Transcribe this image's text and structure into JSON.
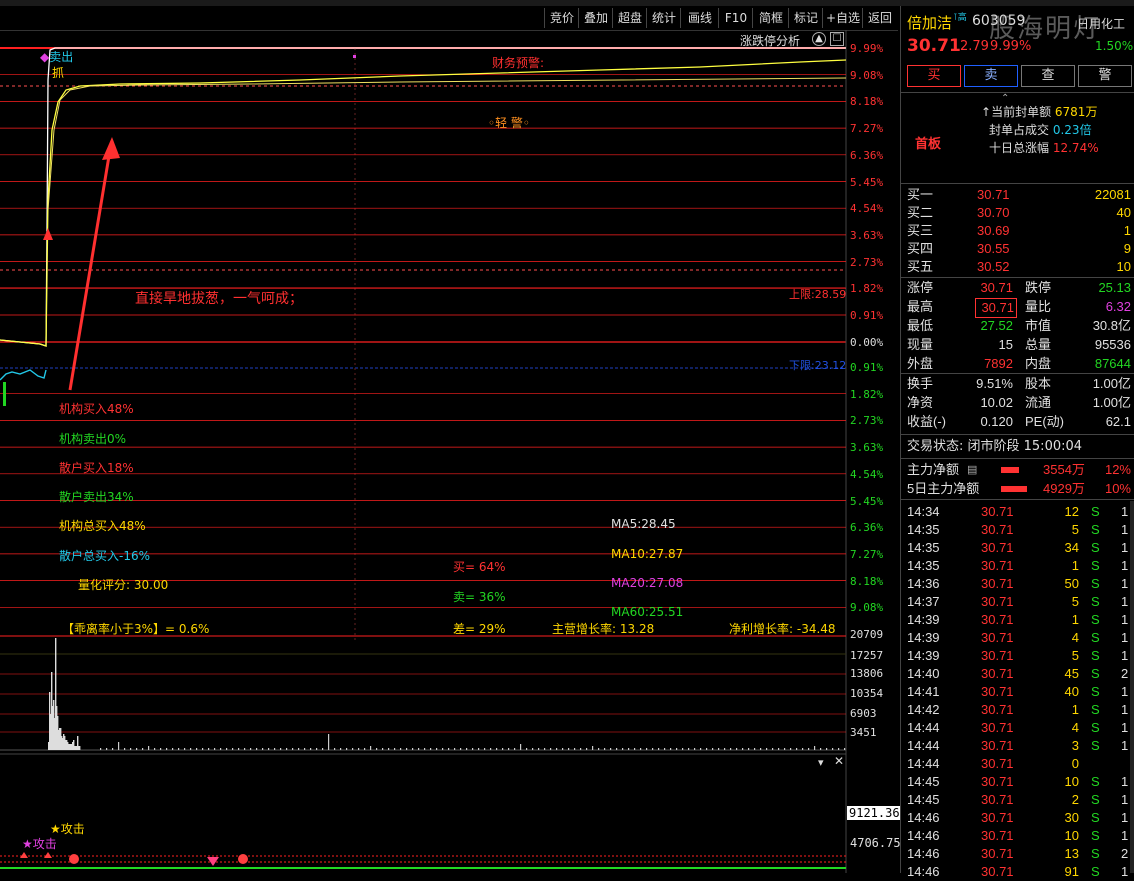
{
  "toolbar": {
    "items": [
      "竞价",
      "叠加",
      "超盘",
      "统计",
      "画线",
      "F10",
      "简框",
      "标记",
      "+自选",
      "返回"
    ]
  },
  "chart": {
    "analysis_label": "涨跌停分析",
    "pct_upper": [
      "9.99%",
      "9.08%",
      "8.18%",
      "7.27%",
      "6.36%",
      "5.45%",
      "4.54%",
      "3.63%",
      "2.73%",
      "1.82%",
      "0.91%",
      "0.00%"
    ],
    "pct_lower": [
      "0.91%",
      "1.82%",
      "2.73%",
      "3.63%",
      "4.54%",
      "5.45%",
      "6.36%",
      "7.27%",
      "8.18%",
      "9.08%"
    ],
    "vol_ticks": [
      "20709",
      "17257",
      "13806",
      "10354",
      "6903",
      "3451"
    ],
    "sub_ticks": [
      "9121.36",
      "4706.75"
    ],
    "sell_label": "卖出",
    "grab_label": "抓",
    "warning_label": "财务预警:",
    "light_warning": "◦轻 警◦",
    "annotation": "直接旱地拔葱，一气呵成；",
    "upper_limit": "上限:28.59",
    "lower_limit": "下限:23.12",
    "attack1": "★攻击",
    "attack2": "★攻击"
  },
  "indicators": {
    "inst_buy": "机构买入48%",
    "inst_sell": "机构卖出0%",
    "retail_buy": "散户买入18%",
    "retail_sell": "散户卖出34%",
    "inst_total": "机构总买入48%",
    "retail_total": "散户总买入-16%",
    "quant_score": "量化评分: 30.00",
    "deviation": "【乖离率小于3%】= 0.6%",
    "buy": "买= 64%",
    "sell": "卖= 36%",
    "diff": "差= 29%",
    "ma5": "MA5:28.45",
    "ma10": "MA10:27.87",
    "ma20": "MA20:27.08",
    "ma60": "MA60:25.51",
    "main_growth": "主营增长率: 13.28",
    "net_growth": "净利增长率: -34.48"
  },
  "stock": {
    "name": "倍加洁",
    "high_tag": "高",
    "code": "603059",
    "industry": "日用化工",
    "price": "30.71",
    "change": "2.79",
    "change_pct": "9.99%",
    "right_pct": "1.50%",
    "watermark": "股海明灯",
    "buy_btn": "买",
    "sell_btn": "卖",
    "check_btn": "查",
    "alert_btn": "警",
    "board": "首板",
    "seal_amount_label": "当前封单额",
    "seal_amount": "6781万",
    "seal_ratio_label": "封单占成交",
    "seal_ratio": "0.23倍",
    "ten_day_label": "十日总涨幅",
    "ten_day": "12.74%"
  },
  "orderbook": [
    {
      "label": "买一",
      "price": "30.71",
      "vol": "22081"
    },
    {
      "label": "买二",
      "price": "30.70",
      "vol": "40"
    },
    {
      "label": "买三",
      "price": "30.69",
      "vol": "1"
    },
    {
      "label": "买四",
      "price": "30.55",
      "vol": "9"
    },
    {
      "label": "买五",
      "price": "30.52",
      "vol": "10"
    }
  ],
  "stats": [
    [
      "涨停",
      "30.71",
      "跌停",
      "25.13"
    ],
    [
      "最高",
      "30.71",
      "量比",
      "6.32"
    ],
    [
      "最低",
      "27.52",
      "市值",
      "30.8亿"
    ],
    [
      "现量",
      "15",
      "总量",
      "95536"
    ],
    [
      "外盘",
      "7892",
      "内盘",
      "87644"
    ]
  ],
  "stats2": [
    [
      "换手",
      "9.51%",
      "股本",
      "1.00亿"
    ],
    [
      "净资",
      "10.02",
      "流通",
      "1.00亿"
    ],
    [
      "收益(-)",
      "0.120",
      "PE(动)",
      "62.1"
    ]
  ],
  "trade_status": "交易状态: 闭市阶段 15:00:04",
  "flows": [
    {
      "label": "主力净额",
      "amount": "3554万",
      "pct": "12%"
    },
    {
      "label": "5日主力净额",
      "amount": "4929万",
      "pct": "10%"
    }
  ],
  "ticks": [
    [
      "14:34",
      "30.71",
      "12",
      "S",
      "1"
    ],
    [
      "14:35",
      "30.71",
      "5",
      "S",
      "1"
    ],
    [
      "14:35",
      "30.71",
      "34",
      "S",
      "1"
    ],
    [
      "14:35",
      "30.71",
      "1",
      "S",
      "1"
    ],
    [
      "14:36",
      "30.71",
      "50",
      "S",
      "1"
    ],
    [
      "14:37",
      "30.71",
      "5",
      "S",
      "1"
    ],
    [
      "14:39",
      "30.71",
      "1",
      "S",
      "1"
    ],
    [
      "14:39",
      "30.71",
      "4",
      "S",
      "1"
    ],
    [
      "14:39",
      "30.71",
      "5",
      "S",
      "1"
    ],
    [
      "14:40",
      "30.71",
      "45",
      "S",
      "2"
    ],
    [
      "14:41",
      "30.71",
      "40",
      "S",
      "1"
    ],
    [
      "14:42",
      "30.71",
      "1",
      "S",
      "1"
    ],
    [
      "14:44",
      "30.71",
      "4",
      "S",
      "1"
    ],
    [
      "14:44",
      "30.71",
      "3",
      "S",
      "1"
    ],
    [
      "14:44",
      "30.71",
      "0",
      "",
      ""
    ],
    [
      "14:45",
      "30.71",
      "10",
      "S",
      "1"
    ],
    [
      "14:45",
      "30.71",
      "2",
      "S",
      "1"
    ],
    [
      "14:46",
      "30.71",
      "30",
      "S",
      "1"
    ],
    [
      "14:46",
      "30.71",
      "10",
      "S",
      "1"
    ],
    [
      "14:46",
      "30.71",
      "13",
      "S",
      "2"
    ],
    [
      "14:46",
      "30.71",
      "91",
      "S",
      "1"
    ]
  ]
}
